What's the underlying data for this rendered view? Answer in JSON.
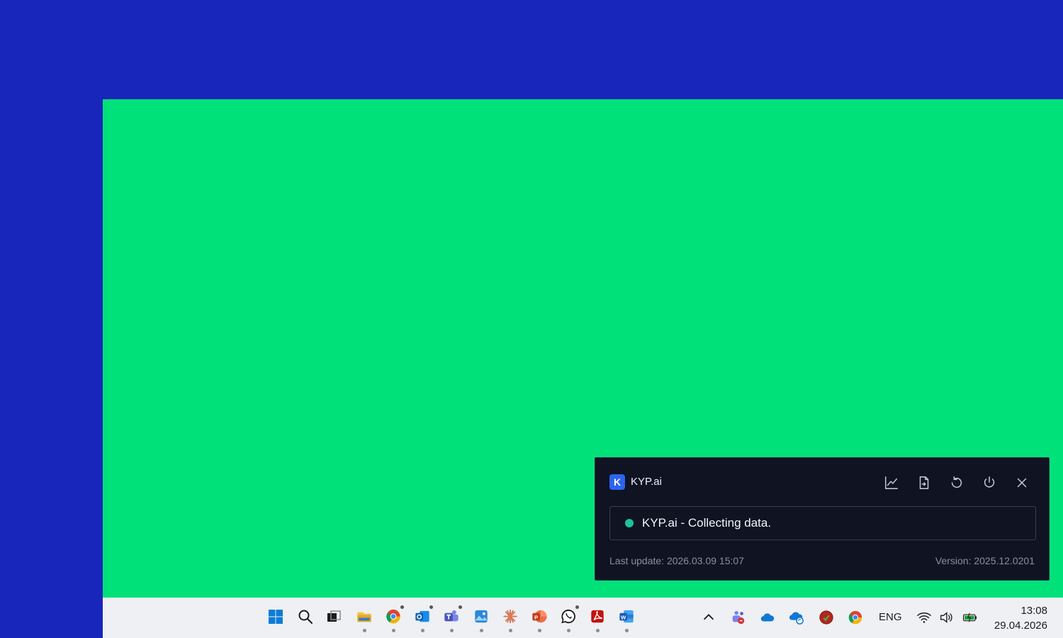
{
  "popup": {
    "logo_letter": "K",
    "title": "KYP.ai",
    "status_text": "KYP.ai - Collecting data.",
    "last_update": "Last update: 2026.03.09 15:07",
    "version": "Version: 2025.12.0201",
    "status_color": "#1dc39a",
    "actions": [
      "chart-icon",
      "document-icon",
      "refresh-icon",
      "power-icon",
      "close-icon"
    ]
  },
  "taskbar": {
    "apps": [
      "windows-start-icon",
      "search-icon",
      "task-view-icon",
      "file-explorer-icon",
      "chrome-icon",
      "outlook-icon",
      "teams-icon",
      "photos-icon",
      "claude-icon",
      "powerpoint-icon",
      "whatsapp-icon",
      "acrobat-icon",
      "word-icon"
    ],
    "tray_icons": [
      "show-hidden-icons-chevron",
      "teams-tray-icon",
      "onedrive-icon",
      "onedrive-sync-icon",
      "security-shield-icon",
      "chrome-tray-icon",
      "wifi-icon",
      "volume-icon",
      "battery-icon"
    ],
    "language": "ENG",
    "time": "13:08",
    "date": "29.04.2026"
  },
  "colors": {
    "outer_background": "#1826bb",
    "desktop_background": "#00e17a",
    "popup_background": "#0f1322"
  }
}
